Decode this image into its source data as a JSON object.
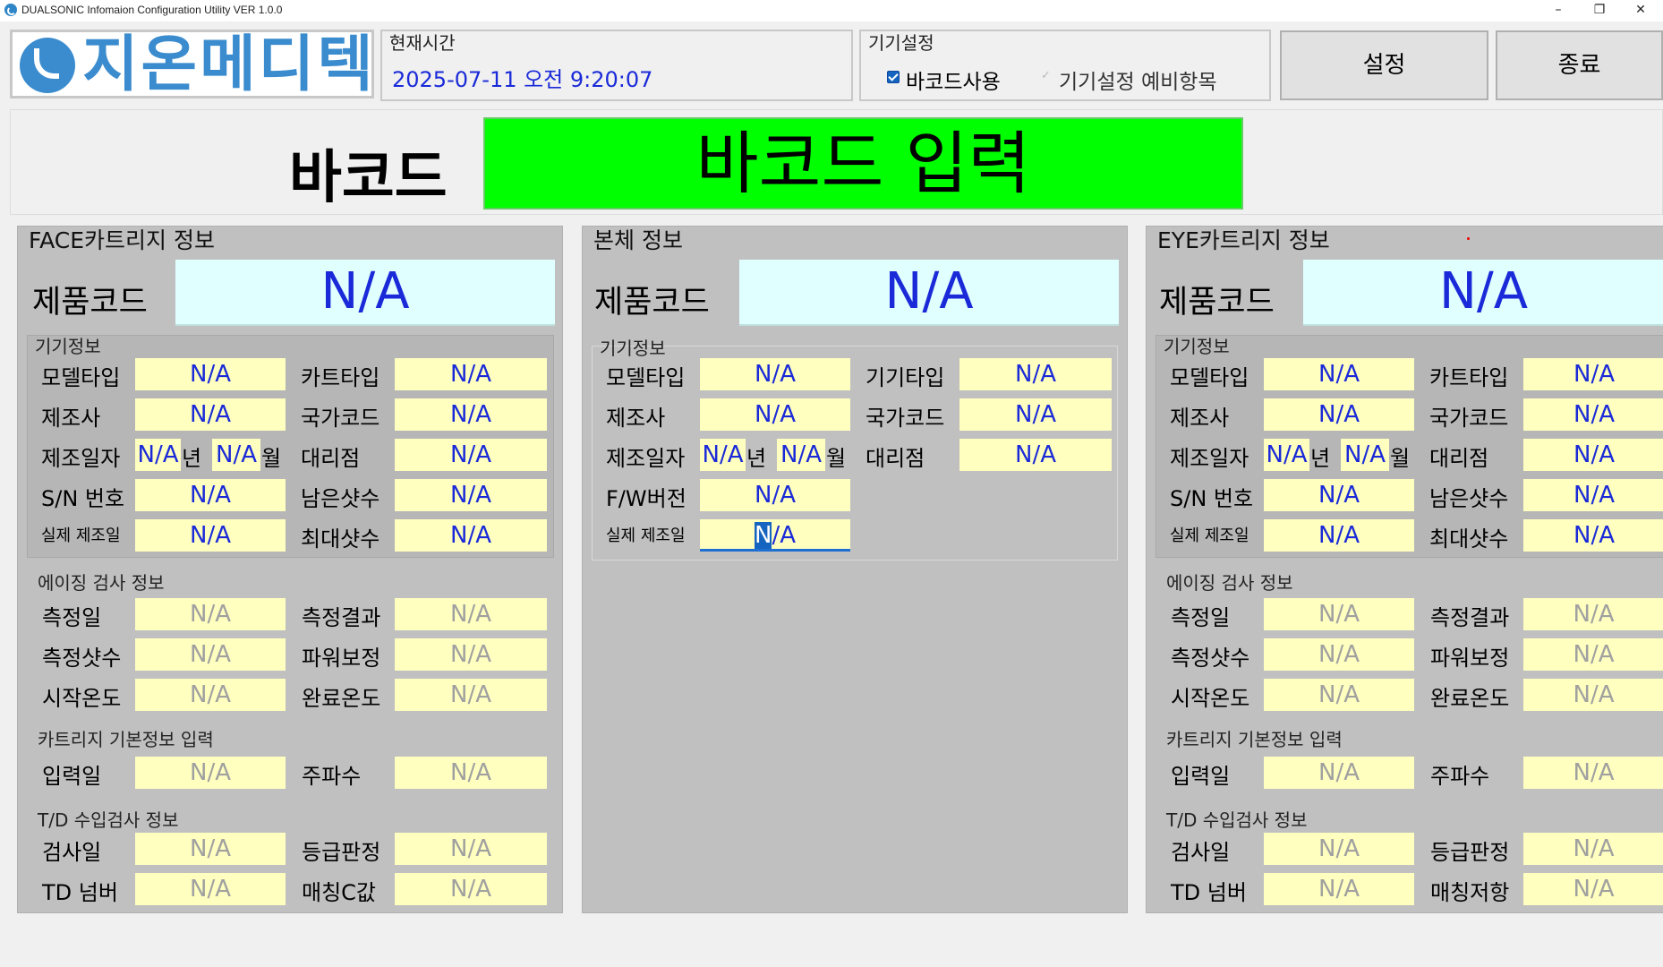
{
  "window": {
    "title": "DUALSONIC Infomaion Configuration Utility VER 1.0.0",
    "minimize": "–",
    "restore": "❐",
    "close": "✕"
  },
  "logo": {
    "text": "지온메디텍"
  },
  "time": {
    "caption": "현재시간",
    "value": "2025-07-11 오전 9:20:07"
  },
  "device_settings": {
    "caption": "기기설정",
    "barcode_use": "바코드사용",
    "spare_item": "기기설정 예비항목"
  },
  "buttons": {
    "settings": "설정",
    "exit": "종료"
  },
  "barcode": {
    "label": "바코드",
    "input": "바코드 입력"
  },
  "face": {
    "title": "FACE카트리지 정보",
    "code_label": "제품코드",
    "code_value": "N/A",
    "device_caption": "기기정보",
    "model_type": "모델타입",
    "model_type_val": "N/A",
    "cart_type": "카트타입",
    "cart_type_val": "N/A",
    "maker": "제조사",
    "maker_val": "N/A",
    "country": "국가코드",
    "country_val": "N/A",
    "mfg_date": "제조일자",
    "year_val": "N/A",
    "year_unit": "년",
    "month_val": "N/A",
    "month_unit": "월",
    "agency": "대리점",
    "agency_val": "N/A",
    "sn": "S/N 번호",
    "sn_val": "N/A",
    "shots_left": "남은샷수",
    "shots_left_val": "N/A",
    "actual_date": "실제 제조일",
    "actual_date_val": "N/A",
    "max_shots": "최대샷수",
    "max_shots_val": "N/A",
    "aging_caption": "에이징 검사 정보",
    "measure_date": "측정일",
    "measure_date_val": "N/A",
    "measure_result": "측정결과",
    "measure_result_val": "N/A",
    "measure_shots": "측정샷수",
    "measure_shots_val": "N/A",
    "power_corr": "파워보정",
    "power_corr_val": "N/A",
    "start_temp": "시작온도",
    "start_temp_val": "N/A",
    "end_temp": "완료온도",
    "end_temp_val": "N/A",
    "basic_caption": "카트리지 기본정보 입력",
    "input_date": "입력일",
    "input_date_val": "N/A",
    "frequency": "주파수",
    "frequency_val": "N/A",
    "td_caption": "T/D 수입검사 정보",
    "inspect_date": "검사일",
    "inspect_date_val": "N/A",
    "grade": "등급판정",
    "grade_val": "N/A",
    "td_number": "TD 넘버",
    "td_number_val": "N/A",
    "matching": "매칭C값",
    "matching_val": "N/A"
  },
  "body": {
    "title": "본체 정보",
    "code_label": "제품코드",
    "code_value": "N/A",
    "device_caption": "기기정보",
    "model_type": "모델타입",
    "model_type_val": "N/A",
    "device_type": "기기타입",
    "device_type_val": "N/A",
    "maker": "제조사",
    "maker_val": "N/A",
    "country": "국가코드",
    "country_val": "N/A",
    "mfg_date": "제조일자",
    "year_val": "N/A",
    "year_unit": "년",
    "month_val": "N/A",
    "month_unit": "월",
    "agency": "대리점",
    "agency_val": "N/A",
    "fw": "F/W버전",
    "fw_val": "N/A",
    "actual_date": "실제 제조일",
    "actual_date_sel": "N",
    "actual_date_rest": "/A"
  },
  "eye": {
    "title": "EYE카트리지 정보",
    "code_label": "제품코드",
    "code_value": "N/A",
    "device_caption": "기기정보",
    "model_type": "모델타입",
    "model_type_val": "N/A",
    "cart_type": "카트타입",
    "cart_type_val": "N/A",
    "maker": "제조사",
    "maker_val": "N/A",
    "country": "국가코드",
    "country_val": "N/A",
    "mfg_date": "제조일자",
    "year_val": "N/A",
    "year_unit": "년",
    "month_val": "N/A",
    "month_unit": "월",
    "agency": "대리점",
    "agency_val": "N/A",
    "sn": "S/N 번호",
    "sn_val": "N/A",
    "shots_left": "남은샷수",
    "shots_left_val": "N/A",
    "actual_date": "실제 제조일",
    "actual_date_val": "N/A",
    "max_shots": "최대샷수",
    "max_shots_val": "N/A",
    "aging_caption": "에이징 검사 정보",
    "measure_date": "측정일",
    "measure_date_val": "N/A",
    "measure_result": "측정결과",
    "measure_result_val": "N/A",
    "measure_shots": "측정샷수",
    "measure_shots_val": "N/A",
    "power_corr": "파워보정",
    "power_corr_val": "N/A",
    "start_temp": "시작온도",
    "start_temp_val": "N/A",
    "end_temp": "완료온도",
    "end_temp_val": "N/A",
    "basic_caption": "카트리지 기본정보 입력",
    "input_date": "입력일",
    "input_date_val": "N/A",
    "frequency": "주파수",
    "frequency_val": "N/A",
    "td_caption": "T/D 수입검사 정보",
    "inspect_date": "검사일",
    "inspect_date_val": "N/A",
    "grade": "등급판정",
    "grade_val": "N/A",
    "td_number": "TD 넘버",
    "td_number_val": "N/A",
    "matching": "매칭저항",
    "matching_val": "N/A"
  },
  "colors": {
    "accent_blue": "#1a2ad8",
    "barcode_green": "#00ff00",
    "code_bg": "#e0ffff",
    "field_bg": "#ffffc0",
    "panel_bg": "#c0c0c0"
  }
}
